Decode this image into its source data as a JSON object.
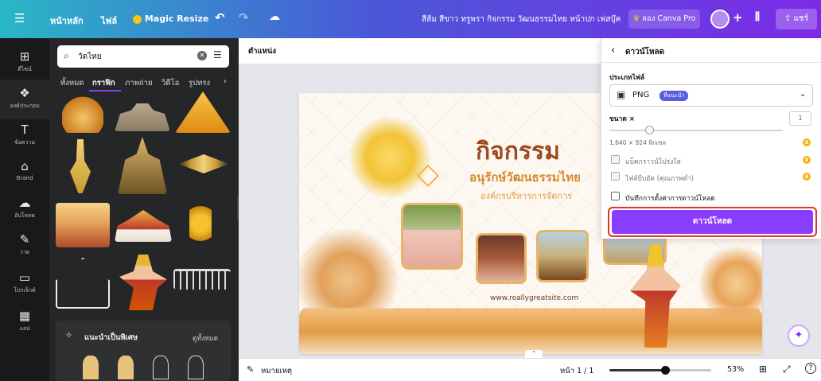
{
  "topbar": {
    "menu_icon": "hamburger-icon",
    "home": "หน้าหลัก",
    "file": "ไฟล์",
    "magic_resize": "Magic Resize",
    "doc_title": "สีส้ม สีขาว ทรูพรา กิจกรรม วัฒนธรรมไทย หน้าปก เฟสบุ๊ค",
    "try_pro": "ลอง Canva Pro",
    "share": "แชร์",
    "accent": "#7d2ae8"
  },
  "rail": [
    {
      "icon": "template-icon",
      "label": "ดีไซน์",
      "glyph": "⊞"
    },
    {
      "icon": "elements-icon",
      "label": "องค์ประกอบ",
      "glyph": "❖"
    },
    {
      "icon": "text-icon",
      "label": "ข้อความ",
      "glyph": "T"
    },
    {
      "icon": "brand-icon",
      "label": "Brand",
      "glyph": "⌂"
    },
    {
      "icon": "upload-icon",
      "label": "อัปโหลด",
      "glyph": "☁"
    },
    {
      "icon": "draw-icon",
      "label": "วาด",
      "glyph": "✎"
    },
    {
      "icon": "projects-icon",
      "label": "โปรเจ็กต์",
      "glyph": "▭"
    },
    {
      "icon": "apps-icon",
      "label": "แอป",
      "glyph": "▦"
    }
  ],
  "panel": {
    "search_value": "วัดไทย",
    "tabs": [
      "ทั้งหมด",
      "กราฟิก",
      "ภาพถ่าย",
      "วิดีโอ",
      "รูปทรง"
    ],
    "active_tab": "กราฟิก",
    "recommend": "แนะนำเป็นพิเศษ",
    "see_all": "ดูทั้งหมด"
  },
  "canvas": {
    "position_label": "ตำแหน่ง",
    "title": "กิจกรรม",
    "subtitle": "อนุรักษ์วัฒนธรรมไทย",
    "org": "องค์กรบริหารการจัดการ",
    "website": "www.reallygreatsite.com"
  },
  "bottombar": {
    "notes": "หมายเหตุ",
    "page": "หน้า 1 / 1",
    "zoom": "53%",
    "zoom_fraction": 0.55
  },
  "download": {
    "header": "ดาวน์โหลด",
    "file_type_label": "ประเภทไฟล์",
    "file_type": "PNG",
    "recommended_badge": "ที่แนะนำ",
    "size_label": "ขนาด ×",
    "size_value": "1",
    "dimensions": "1,640 × 924 พิกเซล",
    "opt_transparent": "แบ็คกราวน์โปร่งใส",
    "opt_compress": "ไฟล์บีบอัด (คุณภาพต่ำ)",
    "opt_save_settings": "บันทึกการตั้งค่าการดาวน์โหลด",
    "button": "ดาวน์โหลด",
    "button_color": "#8b3dff"
  }
}
